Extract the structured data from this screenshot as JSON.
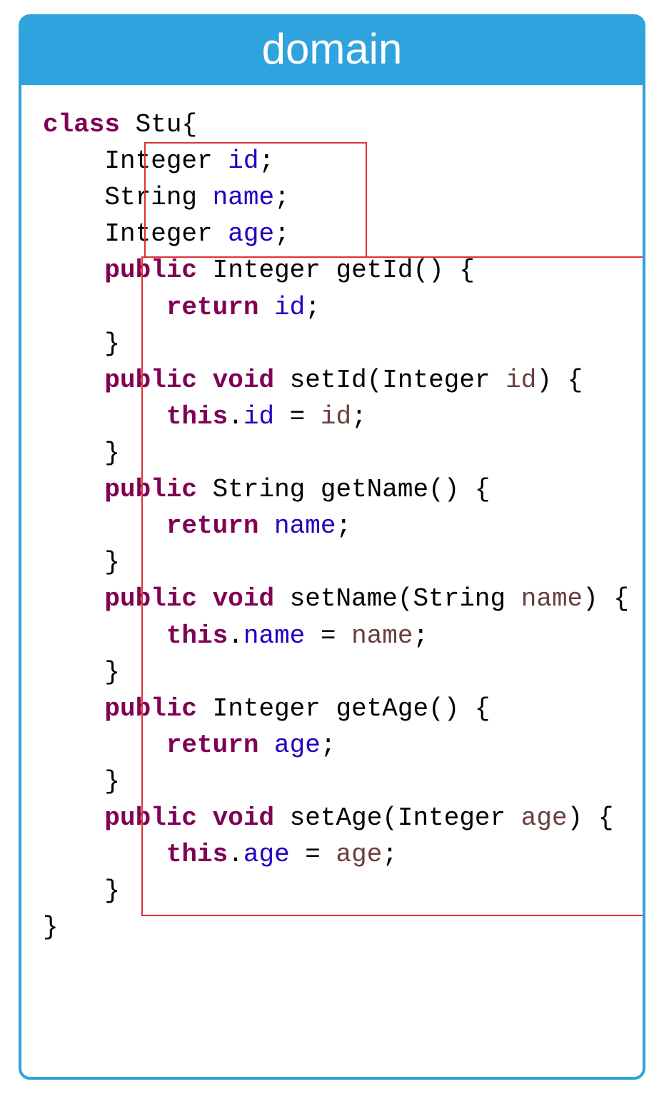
{
  "header_title": "domain",
  "code": {
    "line1_kw": "class",
    "line1_name": " Stu{",
    "line2_type": "    Integer ",
    "line2_field": "id",
    "line2_end": ";",
    "line3_type": "    String ",
    "line3_field": "name",
    "line3_end": ";",
    "line4_type": "    Integer ",
    "line4_field": "age",
    "line4_end": ";",
    "line5_kw": "    public",
    "line5_rest": " Integer getId() {",
    "line6_kw": "        return",
    "line6_field": " id",
    "line6_end": ";",
    "line7": "    }",
    "line8_kw": "    public",
    "line8_void": " void",
    "line8_rest": " setId(Integer ",
    "line8_param": "id",
    "line8_end": ") {",
    "line9_kw": "        this",
    "line9_mid": ".",
    "line9_field": "id",
    "line9_eq": " = ",
    "line9_param": "id",
    "line9_end": ";",
    "line10": "    }",
    "line11_kw": "    public",
    "line11_rest": " String getName() {",
    "line12_kw": "        return",
    "line12_field": " name",
    "line12_end": ";",
    "line13": "    }",
    "line14_kw": "    public",
    "line14_void": " void",
    "line14_rest": " setName(String ",
    "line14_param": "name",
    "line14_end": ") {",
    "line15_kw": "        this",
    "line15_mid": ".",
    "line15_field": "name",
    "line15_eq": " = ",
    "line15_param": "name",
    "line15_end": ";",
    "line16": "    }",
    "line17_kw": "    public",
    "line17_rest": " Integer getAge() {",
    "line18_kw": "        return",
    "line18_field": " age",
    "line18_end": ";",
    "line19": "    }",
    "line20_kw": "    public",
    "line20_void": " void",
    "line20_rest": " setAge(Integer ",
    "line20_param": "age",
    "line20_end": ") {",
    "line21_kw": "        this",
    "line21_mid": ".",
    "line21_field": "age",
    "line21_eq": " = ",
    "line21_param": "age",
    "line21_end": ";",
    "line22": "    }",
    "line23": "}"
  }
}
